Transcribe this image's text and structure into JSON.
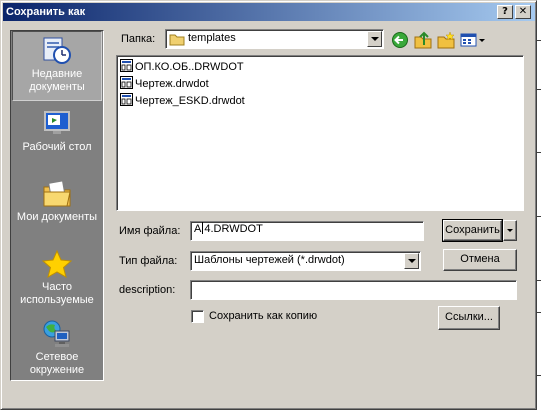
{
  "window": {
    "title": "Сохранить как",
    "help_label": "?",
    "close_label": "✕"
  },
  "places": [
    {
      "label_line1": "Недавние",
      "label_line2": "документы",
      "icon": "recent-documents-icon"
    },
    {
      "label_line1": "Рабочий стол",
      "label_line2": "",
      "icon": "desktop-icon"
    },
    {
      "label_line1": "Мои документы",
      "label_line2": "",
      "icon": "my-documents-icon"
    },
    {
      "label_line1": "Часто",
      "label_line2": "используемые",
      "icon": "favorites-star-icon"
    },
    {
      "label_line1": "Сетевое",
      "label_line2": "окружение",
      "icon": "network-icon"
    }
  ],
  "folder": {
    "label": "Папка:",
    "value": "templates"
  },
  "toolbar": {
    "back_icon": "back-arrow-icon",
    "up_icon": "up-folder-icon",
    "new_folder_icon": "new-folder-icon",
    "views_icon": "views-menu-icon"
  },
  "files": [
    {
      "name": "ОП.КО.ОБ..DRWDOT"
    },
    {
      "name": "Чертеж.drwdot"
    },
    {
      "name": "Чертеж_ESKD.drwdot"
    }
  ],
  "filename": {
    "label": "Имя файла:",
    "value_before_caret": "A",
    "value_after_caret": "4.DRWDOT"
  },
  "filetype": {
    "label": "Тип файла:",
    "value": "Шаблоны чертежей (*.drwdot)"
  },
  "description": {
    "label": "description:",
    "value": ""
  },
  "save_copy": {
    "label": "Сохранить как копию",
    "checked": false
  },
  "buttons": {
    "save": "Сохранить",
    "cancel": "Отмена",
    "links": "Ссылки..."
  },
  "colors": {
    "title_start": "#0a246a",
    "title_end": "#a6caf0",
    "face": "#d4d0c8",
    "places_bg": "#808080"
  }
}
